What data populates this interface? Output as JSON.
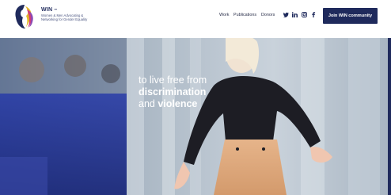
{
  "brand": {
    "title": "WIN –",
    "subtitle": "Women & Men Advocating & Networking for Gender Equality",
    "logo": "profile-faces-logo"
  },
  "nav": {
    "items": [
      "Work",
      "Publications",
      "Donors"
    ],
    "social_icons": [
      "twitter-icon",
      "linkedin-icon",
      "instagram-icon",
      "facebook-icon"
    ],
    "cta_label": "Join WIN community"
  },
  "hero": {
    "line1": "to live free from",
    "line2": "discrimination",
    "line3_prefix": "and ",
    "line3_bold": "violence"
  },
  "colors": {
    "brand_navy": "#1f2a5c",
    "hero_overlay": "#2a3d9a"
  }
}
